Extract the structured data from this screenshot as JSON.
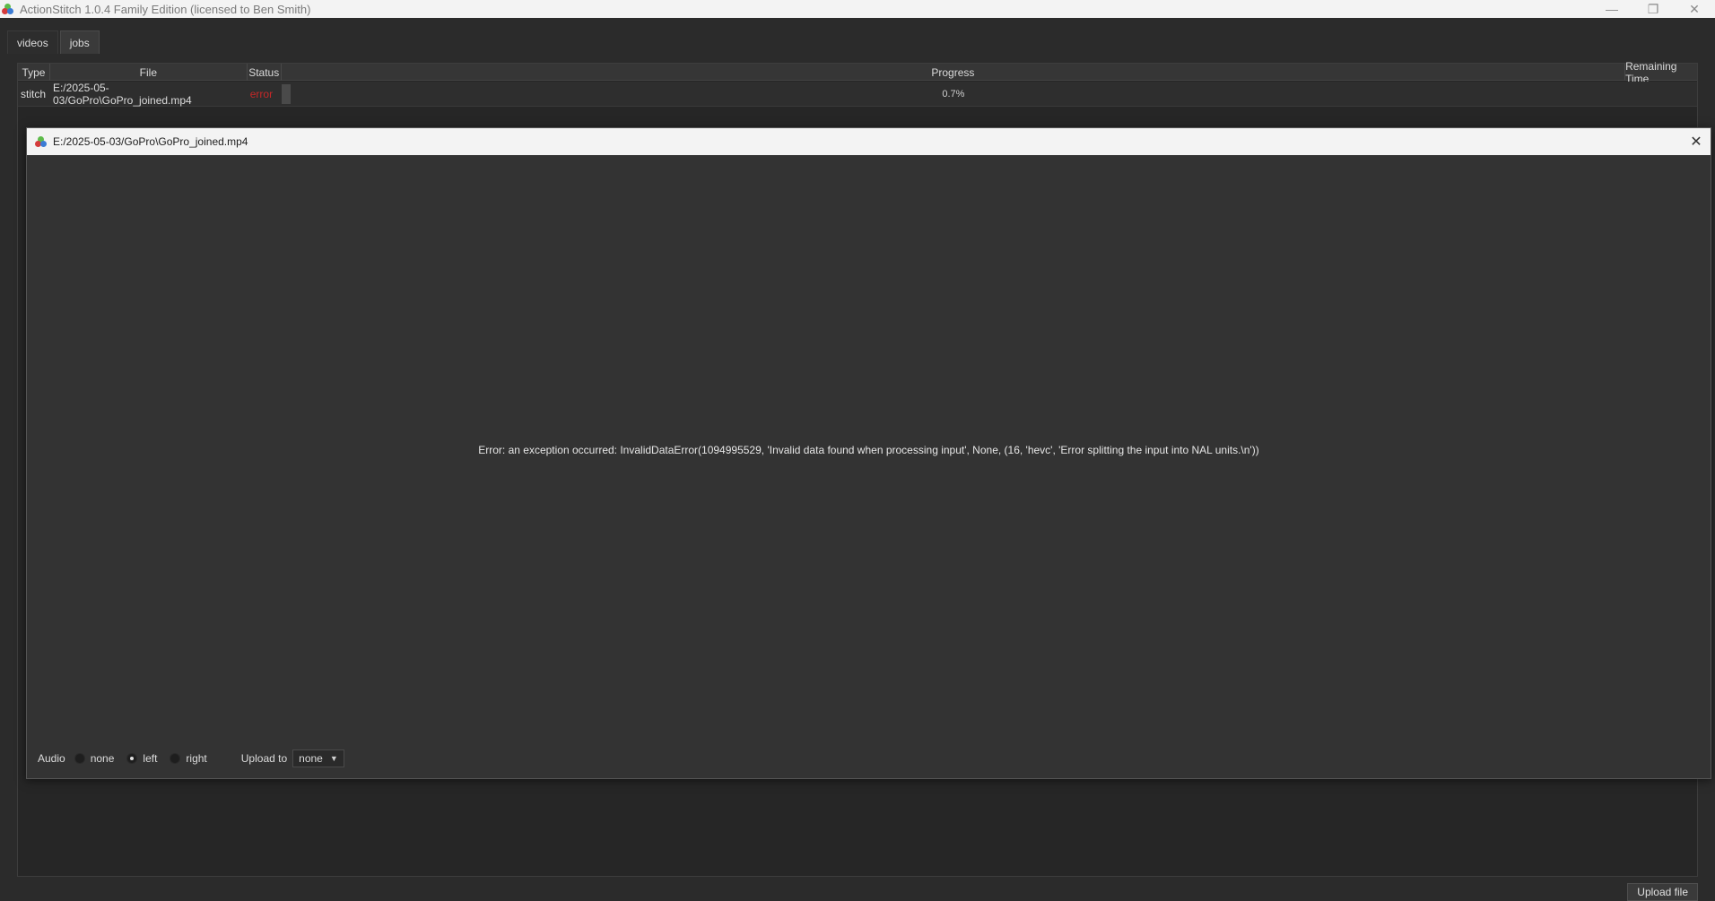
{
  "window": {
    "title": "ActionStitch 1.0.4 Family Edition (licensed to Ben Smith)",
    "controls": {
      "minimize": "—",
      "restore": "❐",
      "close": "✕"
    }
  },
  "tabs": [
    {
      "label": "videos",
      "active": false
    },
    {
      "label": "jobs",
      "active": true
    }
  ],
  "jobs_table": {
    "columns": [
      "Type",
      "File",
      "Status",
      "Progress",
      "Remaining Time"
    ],
    "rows": [
      {
        "type": "stitch",
        "file": "E:/2025-05-03/GoPro\\GoPro_joined.mp4",
        "status": "error",
        "progress_text": "0.7%",
        "progress_value": 0.007,
        "remaining_time": ""
      }
    ]
  },
  "dialog": {
    "title": "E:/2025-05-03/GoPro\\GoPro_joined.mp4",
    "close_glyph": "✕",
    "error_message": "Error: an exception occurred: InvalidDataError(1094995529, 'Invalid data found when processing input', None, (16, 'hevc', 'Error splitting the input into NAL units.\\n'))",
    "audio": {
      "label": "Audio",
      "options": [
        {
          "label": "none",
          "checked": false
        },
        {
          "label": "left",
          "checked": true
        },
        {
          "label": "right",
          "checked": false
        }
      ]
    },
    "upload": {
      "label": "Upload to",
      "selected": "none"
    }
  },
  "footer": {
    "upload_button": "Upload file"
  },
  "colors": {
    "status_error": "#c62828",
    "background": "#2b2b2b",
    "dialog_bg": "#333333"
  }
}
